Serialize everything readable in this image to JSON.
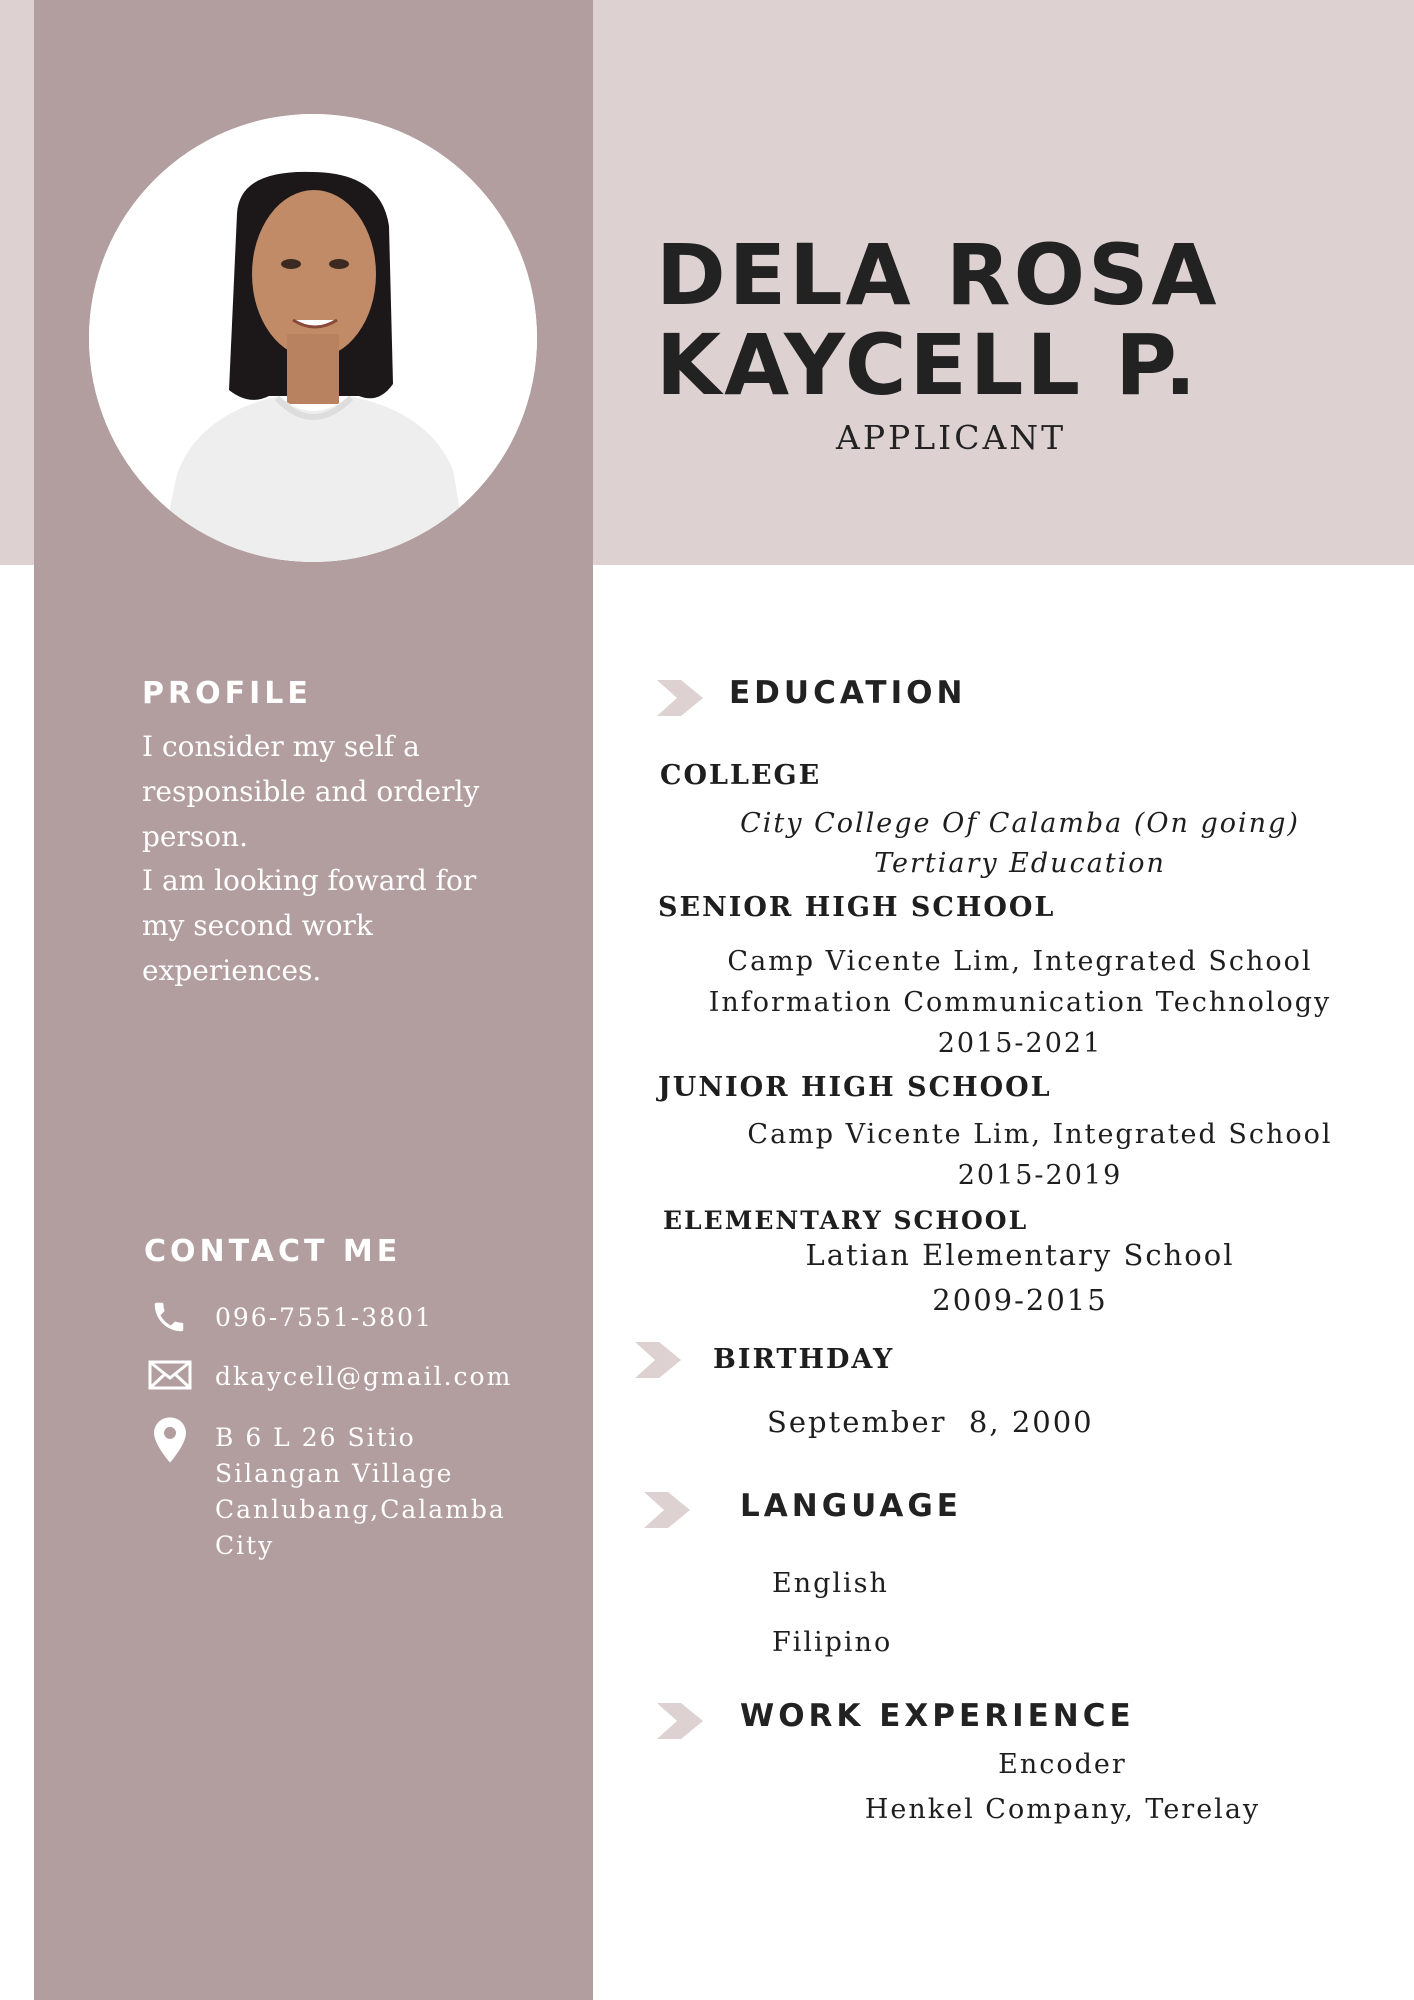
{
  "colors": {
    "top_band": "#ddd1d2",
    "sidebar": "#b29d9f",
    "chevron": "#ddd1d2",
    "text_dark": "#1e1e1e"
  },
  "header": {
    "last_name": "DELA ROSA",
    "first_name": "KAYCELL P.",
    "role": "APPLICANT"
  },
  "profile": {
    "heading": "PROFILE",
    "lines": [
      "I consider my self a",
      "responsible and orderly",
      "person.",
      "I am looking foward for",
      "my second work",
      "experiences."
    ]
  },
  "contact": {
    "heading": "CONTACT ME",
    "phone": "096-7551-3801",
    "email": "dkaycell@gmail.com",
    "address_lines": [
      "B 6 L 26 Sitio",
      "Silangan Village",
      "Canlubang,Calamba",
      "City"
    ],
    "icons": [
      "phone-icon",
      "envelope-icon",
      "location-pin-icon"
    ]
  },
  "education": {
    "heading": "EDUCATION",
    "college": {
      "label": "COLLEGE",
      "school": "City College Of Calamba (On going)",
      "detail": "Tertiary Education"
    },
    "senior_high": {
      "label": "SENIOR HIGH SCHOOL",
      "school": "Camp Vicente Lim, Integrated School",
      "strand": "Information Communication Technology",
      "years": "2015-2021"
    },
    "junior_high": {
      "label": "JUNIOR HIGH SCHOOL",
      "school": "Camp Vicente Lim, Integrated School",
      "years": "2015-2019"
    },
    "elementary": {
      "label": "ELEMENTARY SCHOOL",
      "school": "Latian Elementary School",
      "years": "2009-2015"
    }
  },
  "birthday": {
    "heading": "BIRTHDAY",
    "value": "September  8, 2000"
  },
  "language": {
    "heading": "LANGUAGE",
    "items": [
      "English",
      "Filipino"
    ]
  },
  "work": {
    "heading": "WORK EXPERIENCE",
    "position": "Encoder",
    "company": "Henkel Company, Terelay"
  }
}
